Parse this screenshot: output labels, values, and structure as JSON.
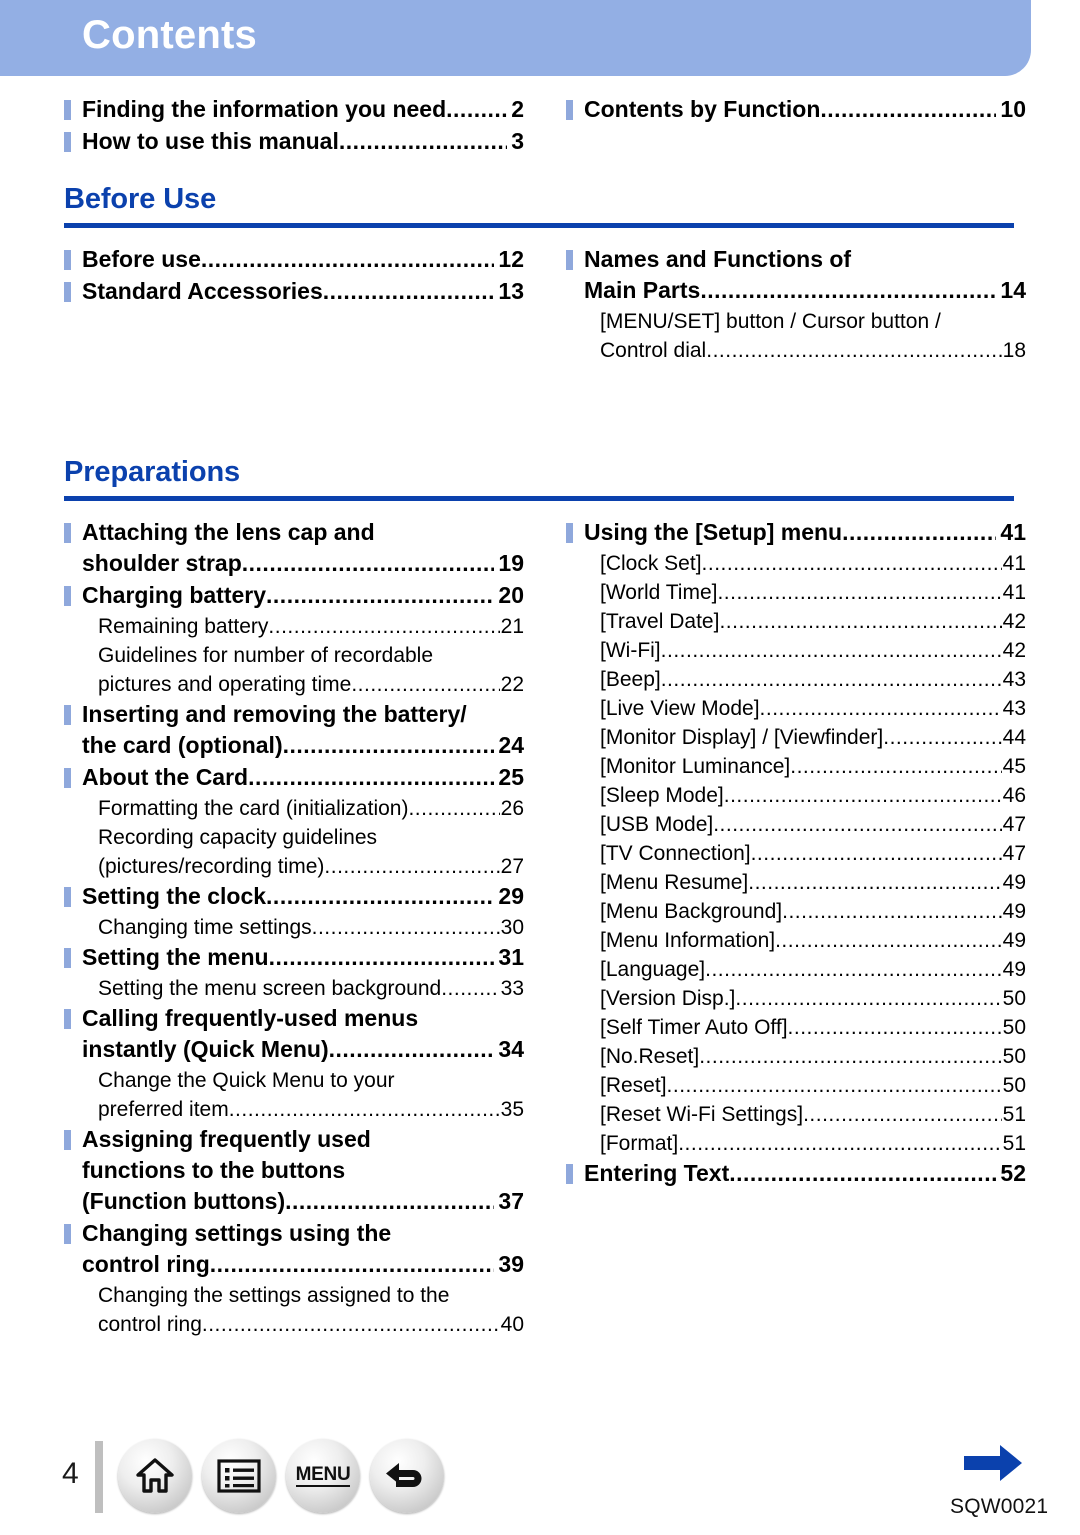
{
  "header": {
    "title": "Contents",
    "banner_color": "#93AFE4"
  },
  "colors": {
    "accent_blue": "#0B41AD",
    "bullet_blue": "#8FA8DC",
    "banner_blue": "#93AFE4"
  },
  "intro": {
    "left": [
      {
        "text": "Finding the information you need",
        "page": "2"
      },
      {
        "text": "How to use this manual",
        "page": "3"
      }
    ],
    "right": [
      {
        "text": "Contents by Function",
        "page": "10"
      }
    ]
  },
  "sections": [
    {
      "title": "Before Use",
      "left": [
        {
          "type": "main",
          "lines": [
            "Before use"
          ],
          "page": "12"
        },
        {
          "type": "main",
          "lines": [
            "Standard Accessories"
          ],
          "page": "13"
        }
      ],
      "right": [
        {
          "type": "main",
          "lines": [
            "Names and Functions of",
            "Main Parts"
          ],
          "page": "14"
        },
        {
          "type": "sub",
          "lines": [
            "[MENU/SET] button / Cursor button /",
            "Control dial"
          ],
          "page": "18"
        }
      ]
    },
    {
      "title": "Preparations",
      "left": [
        {
          "type": "main",
          "lines": [
            "Attaching the lens cap and",
            "shoulder strap"
          ],
          "page": "19"
        },
        {
          "type": "main",
          "lines": [
            "Charging battery"
          ],
          "page": "20"
        },
        {
          "type": "sub",
          "lines": [
            "Remaining battery"
          ],
          "page": "21"
        },
        {
          "type": "sub",
          "lines": [
            "Guidelines for number of recordable",
            "pictures and operating time"
          ],
          "page": "22"
        },
        {
          "type": "main",
          "lines": [
            "Inserting and removing the battery/",
            "the card (optional)"
          ],
          "page": "24"
        },
        {
          "type": "main",
          "lines": [
            "About the Card"
          ],
          "page": "25"
        },
        {
          "type": "sub",
          "lines": [
            "Formatting the card (initialization)"
          ],
          "page": "26"
        },
        {
          "type": "sub",
          "lines": [
            "Recording capacity guidelines",
            "(pictures/recording time)"
          ],
          "page": "27"
        },
        {
          "type": "main",
          "lines": [
            "Setting the clock"
          ],
          "page": "29"
        },
        {
          "type": "sub",
          "lines": [
            "Changing time settings"
          ],
          "page": "30"
        },
        {
          "type": "main",
          "lines": [
            "Setting the menu"
          ],
          "page": "31"
        },
        {
          "type": "sub",
          "lines": [
            "Setting the menu screen background"
          ],
          "page": "33"
        },
        {
          "type": "main",
          "lines": [
            "Calling frequently-used menus",
            "instantly  (Quick Menu)"
          ],
          "page": "34"
        },
        {
          "type": "sub",
          "lines": [
            "Change the Quick Menu to your",
            "preferred item"
          ],
          "page": "35"
        },
        {
          "type": "main",
          "lines": [
            "Assigning frequently used",
            "functions to the buttons",
            "(Function buttons)"
          ],
          "page": "37"
        },
        {
          "type": "main",
          "lines": [
            "Changing settings using the",
            "control ring"
          ],
          "page": "39"
        },
        {
          "type": "sub",
          "lines": [
            "Changing the settings assigned to the",
            "control ring"
          ],
          "page": "40"
        }
      ],
      "right": [
        {
          "type": "main",
          "lines": [
            "Using the [Setup] menu"
          ],
          "page": "41"
        },
        {
          "type": "sub",
          "lines": [
            "[Clock Set]"
          ],
          "page": "41"
        },
        {
          "type": "sub",
          "lines": [
            "[World Time]"
          ],
          "page": "41"
        },
        {
          "type": "sub",
          "lines": [
            "[Travel Date]"
          ],
          "page": "42"
        },
        {
          "type": "sub",
          "lines": [
            "[Wi-Fi]"
          ],
          "page": "42"
        },
        {
          "type": "sub",
          "lines": [
            "[Beep]"
          ],
          "page": "43"
        },
        {
          "type": "sub",
          "lines": [
            "[Live View Mode]"
          ],
          "page": "43"
        },
        {
          "type": "sub",
          "lines": [
            "[Monitor Display] / [Viewfinder]"
          ],
          "page": "44"
        },
        {
          "type": "sub",
          "lines": [
            "[Monitor Luminance]"
          ],
          "page": "45"
        },
        {
          "type": "sub",
          "lines": [
            "[Sleep Mode]"
          ],
          "page": "46"
        },
        {
          "type": "sub",
          "lines": [
            "[USB Mode]"
          ],
          "page": "47"
        },
        {
          "type": "sub",
          "lines": [
            "[TV Connection]"
          ],
          "page": "47"
        },
        {
          "type": "sub",
          "lines": [
            "[Menu Resume]"
          ],
          "page": "49"
        },
        {
          "type": "sub",
          "lines": [
            "[Menu Background]"
          ],
          "page": "49"
        },
        {
          "type": "sub",
          "lines": [
            "[Menu Information]"
          ],
          "page": "49"
        },
        {
          "type": "sub",
          "lines": [
            "[Language]"
          ],
          "page": "49"
        },
        {
          "type": "sub",
          "lines": [
            "[Version Disp.]"
          ],
          "page": "50"
        },
        {
          "type": "sub",
          "lines": [
            "[Self Timer Auto Off]"
          ],
          "page": "50"
        },
        {
          "type": "sub",
          "lines": [
            "[No.Reset]"
          ],
          "page": "50"
        },
        {
          "type": "sub",
          "lines": [
            "[Reset]"
          ],
          "page": "50"
        },
        {
          "type": "sub",
          "lines": [
            "[Reset Wi-Fi Settings]"
          ],
          "page": "51"
        },
        {
          "type": "sub",
          "lines": [
            "[Format]"
          ],
          "page": "51"
        },
        {
          "type": "main",
          "lines": [
            "Entering Text"
          ],
          "page": "52"
        }
      ]
    }
  ],
  "footer": {
    "page_number": "4",
    "nav": [
      {
        "name": "home",
        "label": ""
      },
      {
        "name": "contents",
        "label": ""
      },
      {
        "name": "menu",
        "label": "MENU"
      },
      {
        "name": "back",
        "label": ""
      }
    ],
    "document_code": "SQW0021",
    "arrow_color": "#0B41AD"
  }
}
